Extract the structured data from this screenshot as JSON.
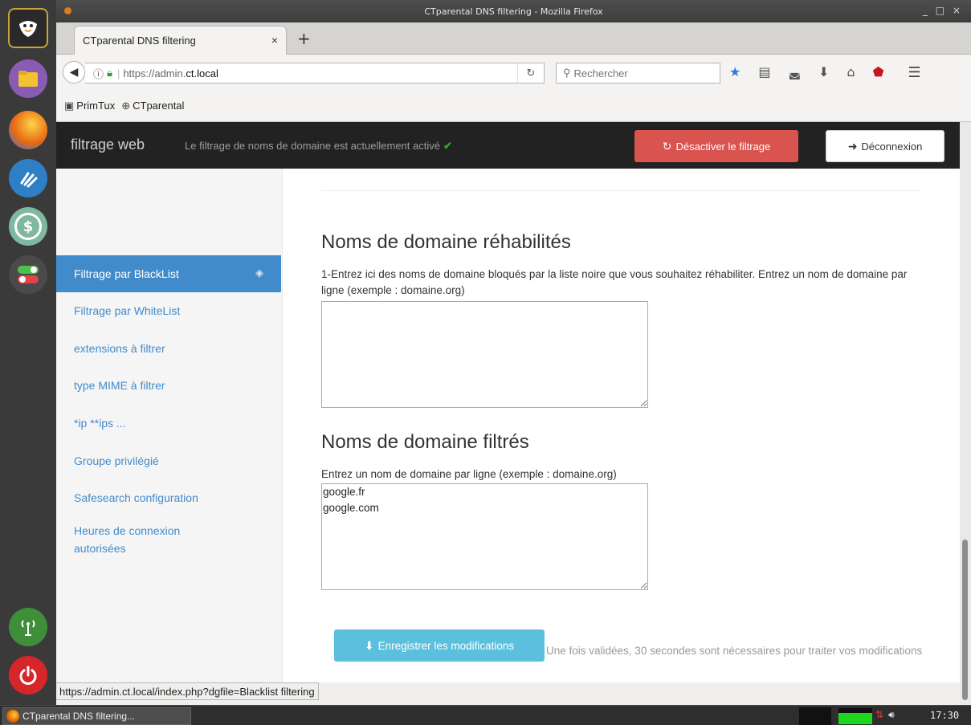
{
  "window": {
    "title": "CTparental DNS filtering - Mozilla Firefox",
    "controls": "_ □ ×"
  },
  "browser": {
    "tab_label": "CTparental DNS filtering",
    "tab_close": "×",
    "new_tab": "+",
    "url_prefix": "https://admin.",
    "url_host": "ct.local",
    "search_placeholder": "Rechercher",
    "bookmarks": [
      "PrimTux",
      "CTparental"
    ],
    "status_url": "https://admin.ct.local/index.php?dgfile=Blacklist filtering"
  },
  "app": {
    "brand": "filtrage web",
    "status_message": "Le filtrage de noms de domaine est actuellement activé",
    "disable_button": "Désactiver le filtrage",
    "logout_button": "Déconnexion"
  },
  "sidebar": {
    "items": [
      {
        "label": "Filtrage par BlackList",
        "active": true
      },
      {
        "label": "Filtrage par WhiteList"
      },
      {
        "label": "extensions à filtrer"
      },
      {
        "label": "type MIME à filtrer"
      },
      {
        "label": "*ip **ips ..."
      },
      {
        "label": "Groupe privilégié"
      },
      {
        "label": "Safesearch configuration"
      },
      {
        "label": "Heures de connexion autorisées"
      }
    ]
  },
  "main": {
    "rehab_title": "Noms de domaine réhabilités",
    "rehab_help": "1-Entrez ici des noms de domaine bloqués par la liste noire que vous souhaitez réhabiliter. Entrez un nom de domaine par ligne (exemple : domaine.org)",
    "rehab_value": "",
    "filtered_title": "Noms de domaine filtrés",
    "filtered_help": "Entrez un nom de domaine par ligne (exemple : domaine.org)",
    "filtered_value": "google.fr\ngoogle.com",
    "save_button": "Enregistrer les modifications",
    "save_note": "Une fois validées, 30 secondes sont nécessaires pour traiter vos modifications"
  },
  "taskbar": {
    "task_label": "CTparental DNS filtering...",
    "clock": "17:30"
  },
  "colors": {
    "navbar_bg": "#222222",
    "danger": "#d9534f",
    "primary": "#428bca",
    "info": "#5bc0de",
    "active_check": "#2ea82e"
  }
}
